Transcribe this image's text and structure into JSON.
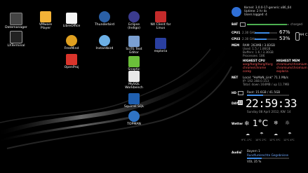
{
  "desktop_icons": [
    {
      "label": "Datemanager"
    },
    {
      "label": "LXTerminal"
    },
    {
      "label": "VMware\nPlayer"
    },
    {
      "label": "LibreOffice"
    },
    {
      "label": "FreeMind"
    },
    {
      "label": "OpenProj"
    },
    {
      "label": "Thunderbird"
    },
    {
      "label": "Instantbird"
    },
    {
      "label": "Eclipse\n(Indigo)"
    },
    {
      "label": "SciTE Text\nEditor"
    },
    {
      "label": "Snaptic"
    },
    {
      "label": "MySQL\nWorkbench"
    },
    {
      "label": "Squirrel SQL"
    },
    {
      "label": "TOPMAN"
    },
    {
      "label": "NX Client for\nLinux"
    },
    {
      "label": "exploria"
    }
  ],
  "conky": {
    "kernel": "Kernel: 3.0.0-17-generic x86_64",
    "uptime": "Uptime: 2 hr 4s",
    "users": "Users logged: 4",
    "bat_label": "BAT",
    "bat_status": "charged",
    "bat_level": 0.95,
    "cpu_label": "CPU",
    "cpu1_label": "CPU1",
    "cpu1_freq": "2.30 GHz",
    "cpu1_pct": "67%",
    "cpu1_level": 0.67,
    "cpu2_label": "CPU2",
    "cpu2_freq": "2.30 GHz",
    "cpu2_pct": "53%",
    "cpu2_level": 0.53,
    "temp": "44 C",
    "mem_label": "MEM",
    "ram": "RAM: 263MB / 3.83GB",
    "mem_lines": [
      "Used: 1.5 / 1.86GB",
      "Buffers: 1.6 / 3.36GB",
      "Processes: 186"
    ],
    "highest_cpu_label": "HIGHEST CPU",
    "highest_mem_label": "HIGHEST MEM",
    "highest_cpu": [
      "xorg/Xorg/Xorg/Xorg",
      "chrome/chrome",
      "conky"
    ],
    "highest_mem": [
      "chromium/chromium",
      "chromium/chromium",
      "exploria"
    ],
    "net_label": "NET",
    "net_lines": [
      "Local: \"HoMaN_Link\"  71.1 Mb/s",
      "IP: 192.168.0.153",
      "Total: down 164MB / up 11.7MB"
    ],
    "hd_label": "HD",
    "hd_text": "Root: 15.6GB / 41.5GB",
    "hd_level": 0.38,
    "day_label": "DAY",
    "day_number": "22",
    "clock": "22:59:33",
    "date": "Sunday 08 April 2012, KW: 14",
    "weather_label": "Wetter",
    "weather_temp": "1°C",
    "forecast": [
      {
        "temp": "9°C  -1°C",
        "icon": "cloud"
      },
      {
        "temp": "10°C  2°C",
        "icon": "rain"
      },
      {
        "temp": "12°C  5°C",
        "icon": "cloud"
      },
      {
        "temp": "12°C  4°C",
        "icon": "rain"
      }
    ],
    "audio_label": "Audio",
    "audio_title": "Bayern 1",
    "audio_sub": "Rundfunkrechte Gegebnisse",
    "audio_level": 0.35,
    "vol": "VOL 35 %"
  },
  "colors": {
    "accent": "#3d8be6",
    "battery": "#4caf50",
    "warn": "#ff5a5a"
  }
}
